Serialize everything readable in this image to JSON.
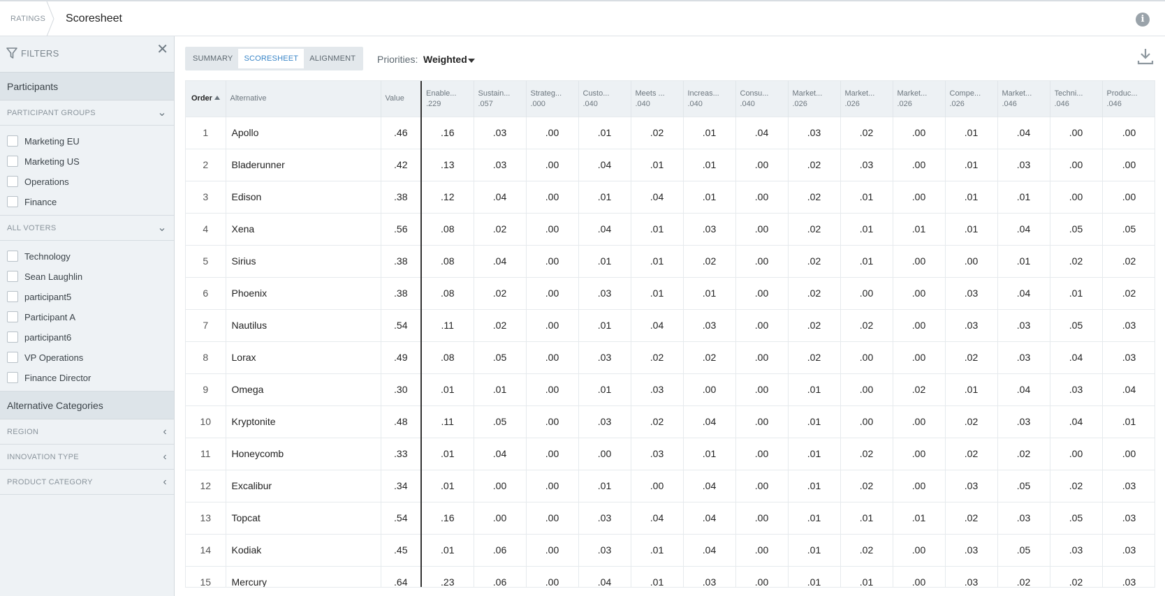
{
  "header": {
    "breadcrumb_root": "RATINGS",
    "title": "Scoresheet"
  },
  "sidebar": {
    "filters_label": "FILTERS",
    "participants_title": "Participants",
    "participant_groups": {
      "label": "PARTICIPANT GROUPS",
      "items": [
        "Marketing EU",
        "Marketing US",
        "Operations",
        "Finance"
      ]
    },
    "all_voters": {
      "label": "ALL VOTERS",
      "items": [
        "Technology",
        "Sean Laughlin",
        "participant5",
        "Participant A",
        "participant6",
        "VP Operations",
        "Finance Director"
      ]
    },
    "alt_categories_title": "Alternative Categories",
    "categories": [
      "REGION",
      "INNOVATION TYPE",
      "PRODUCT CATEGORY"
    ]
  },
  "toolbar": {
    "tabs": [
      "SUMMARY",
      "SCORESHEET",
      "ALIGNMENT"
    ],
    "active_tab": "SCORESHEET",
    "priorities_label": "Priorities:",
    "priorities_value": "Weighted"
  },
  "table": {
    "headers": {
      "order": "Order",
      "alternative": "Alternative",
      "value": "Value"
    },
    "criteria": [
      {
        "name": "Enable...",
        "weight": ".229"
      },
      {
        "name": "Sustain...",
        "weight": ".057"
      },
      {
        "name": "Strateg...",
        "weight": ".000"
      },
      {
        "name": "Custo...",
        "weight": ".040"
      },
      {
        "name": "Meets ...",
        "weight": ".040"
      },
      {
        "name": "Increas...",
        "weight": ".040"
      },
      {
        "name": "Consu...",
        "weight": ".040"
      },
      {
        "name": "Market...",
        "weight": ".026"
      },
      {
        "name": "Market...",
        "weight": ".026"
      },
      {
        "name": "Market...",
        "weight": ".026"
      },
      {
        "name": "Compe...",
        "weight": ".026"
      },
      {
        "name": "Market...",
        "weight": ".046"
      },
      {
        "name": "Techni...",
        "weight": ".046"
      },
      {
        "name": "Produc...",
        "weight": ".046"
      }
    ],
    "rows": [
      {
        "order": "1",
        "alternative": "Apollo",
        "value": ".46",
        "scores": [
          ".16",
          ".03",
          ".00",
          ".01",
          ".02",
          ".01",
          ".04",
          ".03",
          ".02",
          ".00",
          ".01",
          ".04",
          ".00",
          ".00"
        ]
      },
      {
        "order": "2",
        "alternative": "Bladerunner",
        "value": ".42",
        "scores": [
          ".13",
          ".03",
          ".00",
          ".04",
          ".01",
          ".01",
          ".00",
          ".02",
          ".03",
          ".00",
          ".01",
          ".03",
          ".00",
          ".00"
        ]
      },
      {
        "order": "3",
        "alternative": "Edison",
        "value": ".38",
        "scores": [
          ".12",
          ".04",
          ".00",
          ".01",
          ".04",
          ".01",
          ".00",
          ".02",
          ".01",
          ".00",
          ".01",
          ".01",
          ".00",
          ".00"
        ]
      },
      {
        "order": "4",
        "alternative": "Xena",
        "value": ".56",
        "scores": [
          ".08",
          ".02",
          ".00",
          ".04",
          ".01",
          ".03",
          ".00",
          ".02",
          ".01",
          ".01",
          ".01",
          ".04",
          ".05",
          ".05"
        ]
      },
      {
        "order": "5",
        "alternative": "Sirius",
        "value": ".38",
        "scores": [
          ".08",
          ".04",
          ".00",
          ".01",
          ".01",
          ".02",
          ".00",
          ".02",
          ".01",
          ".00",
          ".00",
          ".01",
          ".02",
          ".02"
        ]
      },
      {
        "order": "6",
        "alternative": "Phoenix",
        "value": ".38",
        "scores": [
          ".08",
          ".02",
          ".00",
          ".03",
          ".01",
          ".01",
          ".00",
          ".02",
          ".00",
          ".00",
          ".03",
          ".04",
          ".01",
          ".02"
        ]
      },
      {
        "order": "7",
        "alternative": "Nautilus",
        "value": ".54",
        "scores": [
          ".11",
          ".02",
          ".00",
          ".01",
          ".04",
          ".03",
          ".00",
          ".02",
          ".02",
          ".00",
          ".03",
          ".03",
          ".05",
          ".03"
        ]
      },
      {
        "order": "8",
        "alternative": "Lorax",
        "value": ".49",
        "scores": [
          ".08",
          ".05",
          ".00",
          ".03",
          ".02",
          ".02",
          ".00",
          ".02",
          ".00",
          ".00",
          ".02",
          ".03",
          ".04",
          ".03"
        ]
      },
      {
        "order": "9",
        "alternative": "Omega",
        "value": ".30",
        "scores": [
          ".01",
          ".01",
          ".00",
          ".01",
          ".03",
          ".00",
          ".00",
          ".01",
          ".00",
          ".02",
          ".01",
          ".04",
          ".03",
          ".04"
        ]
      },
      {
        "order": "10",
        "alternative": "Kryptonite",
        "value": ".48",
        "scores": [
          ".11",
          ".05",
          ".00",
          ".03",
          ".02",
          ".04",
          ".00",
          ".01",
          ".00",
          ".00",
          ".02",
          ".03",
          ".04",
          ".01"
        ]
      },
      {
        "order": "11",
        "alternative": "Honeycomb",
        "value": ".33",
        "scores": [
          ".01",
          ".04",
          ".00",
          ".00",
          ".03",
          ".01",
          ".00",
          ".01",
          ".02",
          ".00",
          ".02",
          ".02",
          ".00",
          ".00"
        ]
      },
      {
        "order": "12",
        "alternative": "Excalibur",
        "value": ".34",
        "scores": [
          ".01",
          ".00",
          ".00",
          ".01",
          ".00",
          ".04",
          ".00",
          ".01",
          ".02",
          ".00",
          ".03",
          ".05",
          ".02",
          ".03"
        ]
      },
      {
        "order": "13",
        "alternative": "Topcat",
        "value": ".54",
        "scores": [
          ".16",
          ".00",
          ".00",
          ".03",
          ".04",
          ".04",
          ".00",
          ".01",
          ".01",
          ".01",
          ".02",
          ".03",
          ".05",
          ".03"
        ]
      },
      {
        "order": "14",
        "alternative": "Kodiak",
        "value": ".45",
        "scores": [
          ".01",
          ".06",
          ".00",
          ".03",
          ".01",
          ".04",
          ".00",
          ".01",
          ".02",
          ".00",
          ".03",
          ".05",
          ".03",
          ".03"
        ]
      },
      {
        "order": "15",
        "alternative": "Mercury",
        "value": ".64",
        "scores": [
          ".23",
          ".06",
          ".00",
          ".04",
          ".01",
          ".03",
          ".00",
          ".01",
          ".01",
          ".00",
          ".03",
          ".02",
          ".02",
          ".03"
        ]
      }
    ]
  }
}
